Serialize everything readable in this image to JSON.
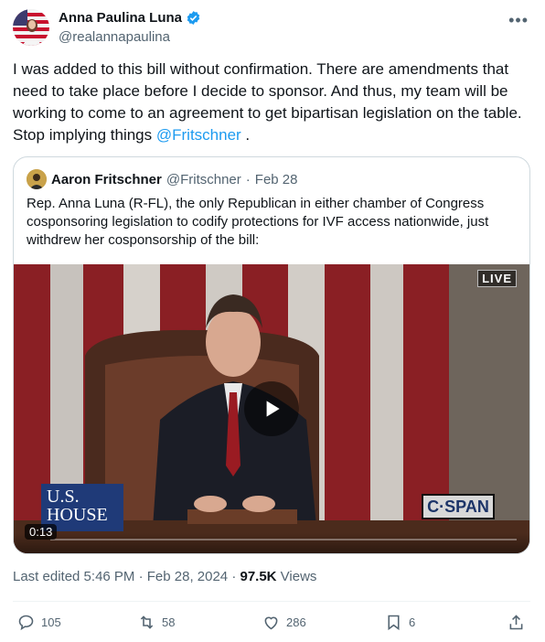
{
  "author": {
    "name": "Anna Paulina Luna",
    "handle": "@realannapaulina",
    "avatar_icon": "profile-photo-flag-background",
    "verified_color": "#1d9bf0"
  },
  "tweet": {
    "text_before": "I was added to this bill without confirmation. There are amendments that  need to take place before I decide to sponsor. And thus, my team will be working to come to an agreement to get bipartisan legislation on the table. Stop implying things ",
    "mention": "@Fritschner",
    "text_after": " ."
  },
  "quote": {
    "name": "Aaron Fritschner",
    "handle": "@Fritschner",
    "dot": "·",
    "date": "Feb 28",
    "text": "Rep. Anna Luna (R-FL), the only Republican in either chamber of Congress cosponsoring legislation to codify protections for IVF access nationwide, just withdrew her cosponsorship of the bill:",
    "video": {
      "live_label": "LIVE",
      "duration": "0:13",
      "house_label_line1": "U.S.",
      "house_label_line2": "HOUSE",
      "network_logo": "C·SPAN"
    }
  },
  "meta": {
    "edited_time": "Last edited 5:46 PM · Feb 28, 2024 · ",
    "views_count": "97.5K",
    "views_label": " Views"
  },
  "actions": {
    "replies": "105",
    "reposts": "58",
    "likes": "286",
    "bookmarks": "6"
  },
  "colors": {
    "accent": "#1d9bf0",
    "secondary_text": "#536471",
    "border": "#cfd9de"
  }
}
